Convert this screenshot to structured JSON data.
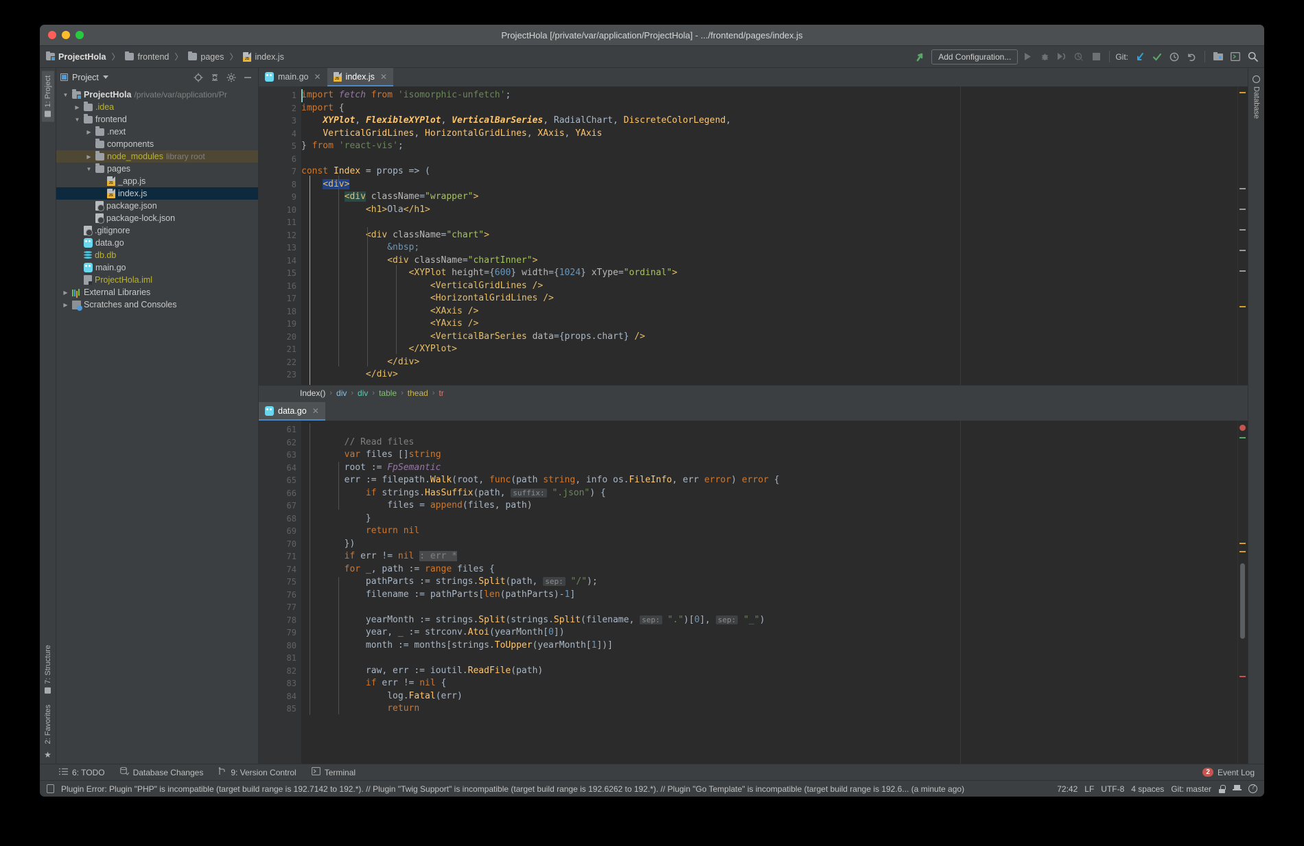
{
  "window": {
    "title": "ProjectHola [/private/var/application/ProjectHola] - .../frontend/pages/index.js"
  },
  "breadcrumb_nav": {
    "items": [
      {
        "label": "ProjectHola",
        "icon": "project-folder-icon"
      },
      {
        "label": "frontend",
        "icon": "folder-icon"
      },
      {
        "label": "pages",
        "icon": "folder-icon"
      },
      {
        "label": "index.js",
        "icon": "js-file-icon"
      }
    ],
    "separator": "〉"
  },
  "toolbar": {
    "add_configuration": "Add Configuration...",
    "git_label": "Git:",
    "icons": [
      "run-icon",
      "debug-icon",
      "run-coverage-icon",
      "profile-icon",
      "stop-icon",
      "git-update-icon",
      "git-commit-icon",
      "git-history-icon",
      "git-rollback-icon",
      "project-structure-icon",
      "terminal-icon",
      "search-icon"
    ]
  },
  "left_stripe": {
    "tabs": [
      {
        "label": "1: Project",
        "active": true
      },
      {
        "label": "7: Structure",
        "active": false
      },
      {
        "label": "2: Favorites",
        "active": false
      }
    ]
  },
  "right_stripe": {
    "tabs": [
      {
        "label": "Database",
        "active": false
      }
    ]
  },
  "project_panel": {
    "header": "Project",
    "tools": [
      "locate-icon",
      "collapse-all-icon",
      "settings-gear-icon",
      "hide-icon"
    ],
    "tree": [
      {
        "indent": 0,
        "arrow": "open",
        "icon": "project-folder-icon",
        "label": "ProjectHola",
        "bold": true,
        "hint": "/private/var/application/Pr",
        "state": "normal"
      },
      {
        "indent": 1,
        "arrow": "closed",
        "icon": "folder-icon",
        "label": ".idea",
        "color": "yellow",
        "state": "normal"
      },
      {
        "indent": 1,
        "arrow": "open",
        "icon": "folder-icon",
        "label": "frontend",
        "state": "normal"
      },
      {
        "indent": 2,
        "arrow": "closed",
        "icon": "folder-icon",
        "label": ".next",
        "state": "normal"
      },
      {
        "indent": 2,
        "arrow": "none",
        "icon": "folder-icon",
        "label": "components",
        "state": "normal"
      },
      {
        "indent": 2,
        "arrow": "closed",
        "icon": "folder-icon",
        "label": "node_modules",
        "color": "yellow",
        "hint": "library root",
        "state": "highlight"
      },
      {
        "indent": 2,
        "arrow": "open",
        "icon": "folder-icon",
        "label": "pages",
        "state": "normal"
      },
      {
        "indent": 3,
        "arrow": "none",
        "icon": "js-file-icon",
        "label": "_app.js",
        "state": "normal"
      },
      {
        "indent": 3,
        "arrow": "none",
        "icon": "js-file-icon",
        "label": "index.js",
        "state": "selected"
      },
      {
        "indent": 2,
        "arrow": "none",
        "icon": "json-file-icon",
        "label": "package.json",
        "state": "normal"
      },
      {
        "indent": 2,
        "arrow": "none",
        "icon": "json-file-icon",
        "label": "package-lock.json",
        "state": "normal"
      },
      {
        "indent": 1,
        "arrow": "none",
        "icon": "gitignore-icon",
        "label": ".gitignore",
        "state": "normal"
      },
      {
        "indent": 1,
        "arrow": "none",
        "icon": "go-file-icon",
        "label": "data.go",
        "state": "normal"
      },
      {
        "indent": 1,
        "arrow": "none",
        "icon": "database-icon",
        "label": "db.db",
        "color": "yellow",
        "state": "normal"
      },
      {
        "indent": 1,
        "arrow": "none",
        "icon": "go-file-icon",
        "label": "main.go",
        "state": "normal"
      },
      {
        "indent": 1,
        "arrow": "none",
        "icon": "iml-file-icon",
        "label": "ProjectHola.iml",
        "color": "yellow",
        "state": "normal"
      },
      {
        "indent": 0,
        "arrow": "closed",
        "icon": "external-libraries-icon",
        "label": "External Libraries",
        "state": "normal"
      },
      {
        "indent": 0,
        "arrow": "closed",
        "icon": "scratches-icon",
        "label": "Scratches and Consoles",
        "state": "normal"
      }
    ]
  },
  "top_editor": {
    "tabs": [
      {
        "label": "main.go",
        "icon": "go-file-icon",
        "active": false
      },
      {
        "label": "index.js",
        "icon": "js-file-icon",
        "active": true
      }
    ],
    "first_line": 1,
    "lines": [
      {
        "n": 1,
        "fold": "minus"
      },
      {
        "n": 2,
        "fold": ""
      },
      {
        "n": 3,
        "fold": ""
      },
      {
        "n": 4,
        "fold": ""
      },
      {
        "n": 5,
        "fold": "end"
      },
      {
        "n": 6,
        "fold": ""
      },
      {
        "n": 7,
        "fold": ""
      },
      {
        "n": 8,
        "fold": "minus"
      },
      {
        "n": 9,
        "fold": "minus"
      },
      {
        "n": 10,
        "fold": ""
      },
      {
        "n": 11,
        "fold": ""
      },
      {
        "n": 12,
        "fold": "minus"
      },
      {
        "n": 13,
        "fold": ""
      },
      {
        "n": 14,
        "fold": "minus"
      },
      {
        "n": 15,
        "fold": "minus"
      },
      {
        "n": 16,
        "fold": ""
      },
      {
        "n": 17,
        "fold": ""
      },
      {
        "n": 18,
        "fold": ""
      },
      {
        "n": 19,
        "fold": ""
      },
      {
        "n": 20,
        "fold": ""
      },
      {
        "n": 21,
        "fold": "end"
      },
      {
        "n": 22,
        "fold": "end"
      },
      {
        "n": 23,
        "fold": "end"
      }
    ],
    "breadcrumbs": [
      "Index()",
      "div",
      "div",
      "table",
      "thead",
      "tr"
    ]
  },
  "bottom_editor": {
    "tabs": [
      {
        "label": "data.go",
        "icon": "go-file-icon",
        "active": true
      }
    ],
    "lines": [
      {
        "n": 61,
        "fold": ""
      },
      {
        "n": 62,
        "fold": ""
      },
      {
        "n": 63,
        "fold": ""
      },
      {
        "n": 64,
        "fold": ""
      },
      {
        "n": 65,
        "fold": "minus"
      },
      {
        "n": 66,
        "fold": "minus"
      },
      {
        "n": 67,
        "fold": ""
      },
      {
        "n": 68,
        "fold": "end"
      },
      {
        "n": 69,
        "fold": ""
      },
      {
        "n": 70,
        "fold": "end"
      },
      {
        "n": 71,
        "fold": "plus"
      },
      {
        "n": 74,
        "fold": "minus"
      },
      {
        "n": 75,
        "fold": ""
      },
      {
        "n": 76,
        "fold": ""
      },
      {
        "n": 77,
        "fold": ""
      },
      {
        "n": 78,
        "fold": ""
      },
      {
        "n": 79,
        "fold": ""
      },
      {
        "n": 80,
        "fold": ""
      },
      {
        "n": 81,
        "fold": ""
      },
      {
        "n": 82,
        "fold": ""
      },
      {
        "n": 83,
        "fold": "minus"
      },
      {
        "n": 84,
        "fold": ""
      },
      {
        "n": 85,
        "fold": ""
      }
    ]
  },
  "bottom_tool_bar": {
    "items": [
      {
        "label": "6: TODO",
        "icon": "todo-icon"
      },
      {
        "label": "Database Changes",
        "icon": "database-changes-icon"
      },
      {
        "label": "9: Version Control",
        "icon": "version-control-icon"
      },
      {
        "label": "Terminal",
        "icon": "terminal-icon"
      }
    ],
    "event_log": {
      "label": "Event Log",
      "count": "2"
    }
  },
  "status_bar": {
    "message": "Plugin Error: Plugin \"PHP\" is incompatible (target build range is 192.7142 to 192.*). // Plugin \"Twig Support\" is incompatible (target build range is 192.6262 to 192.*). // Plugin \"Go Template\" is incompatible (target build range is 192.6... (a minute ago)",
    "caret": "72:42",
    "line_separator": "LF",
    "encoding": "UTF-8",
    "indent": "4 spaces",
    "git_branch": "Git: master",
    "icons": [
      "lock-icon",
      "inspection-icon",
      "help-settings-icon"
    ]
  },
  "colors": {
    "accent_blue": "#4a88c7",
    "selection": "#0d293e",
    "highlight": "#4e4733",
    "editor_bg": "#2b2b2b",
    "panel_bg": "#3c3f41",
    "keyword": "#cc7832",
    "string": "#6a8759",
    "number": "#6897bb",
    "comment": "#808080",
    "function": "#ffc66d",
    "tag": "#e8bf6a",
    "attr_value": "#a5c261",
    "error_red": "#c75450",
    "green": "#6fbf4a"
  }
}
